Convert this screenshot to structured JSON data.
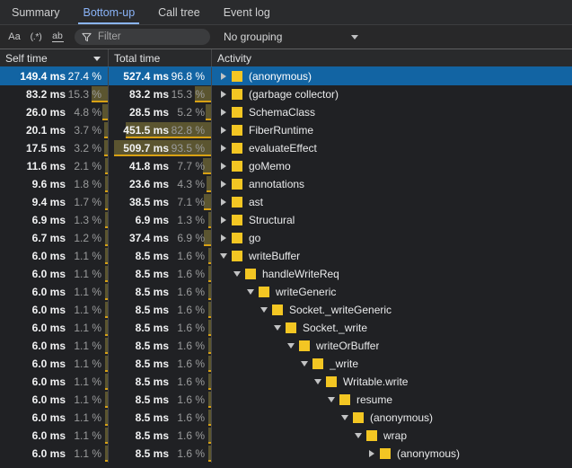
{
  "tabs": [
    {
      "label": "Summary",
      "active": false
    },
    {
      "label": "Bottom-up",
      "active": true
    },
    {
      "label": "Call tree",
      "active": false
    },
    {
      "label": "Event log",
      "active": false
    }
  ],
  "toolbar": {
    "match_case_label": "Aa",
    "regex_label": "(.*)",
    "whole_word_label": "ab",
    "filter_placeholder": "Filter",
    "filter_value": "",
    "grouping_label": "No grouping"
  },
  "columns": {
    "self_time": "Self time",
    "total_time": "Total time",
    "activity": "Activity",
    "sorted_by": "self_time",
    "sort_direction": "desc"
  },
  "colors": {
    "accent": "#8ab4f8",
    "selection": "#1264a3",
    "bar_fill": "#5b5530",
    "bar_border": "#d8a114",
    "swatch": "#f3c623",
    "background": "#202124"
  },
  "rows": [
    {
      "self_ms": "149.4 ms",
      "self_pct": "27.4 %",
      "self_pct_val": 27.4,
      "total_ms": "527.4 ms",
      "total_pct": "96.8 %",
      "total_pct_val": 96.8,
      "activity": "(anonymous)",
      "depth": 0,
      "state": "collapsed",
      "selected": true
    },
    {
      "self_ms": "83.2 ms",
      "self_pct": "15.3 %",
      "self_pct_val": 15.3,
      "total_ms": "83.2 ms",
      "total_pct": "15.3 %",
      "total_pct_val": 15.3,
      "activity": "(garbage collector)",
      "depth": 0,
      "state": "collapsed",
      "selected": false
    },
    {
      "self_ms": "26.0 ms",
      "self_pct": "4.8 %",
      "self_pct_val": 4.8,
      "total_ms": "28.5 ms",
      "total_pct": "5.2 %",
      "total_pct_val": 5.2,
      "activity": "SchemaClass",
      "depth": 0,
      "state": "collapsed",
      "selected": false
    },
    {
      "self_ms": "20.1 ms",
      "self_pct": "3.7 %",
      "self_pct_val": 3.7,
      "total_ms": "451.5 ms",
      "total_pct": "82.8 %",
      "total_pct_val": 82.8,
      "activity": "FiberRuntime",
      "depth": 0,
      "state": "collapsed",
      "selected": false
    },
    {
      "self_ms": "17.5 ms",
      "self_pct": "3.2 %",
      "self_pct_val": 3.2,
      "total_ms": "509.7 ms",
      "total_pct": "93.5 %",
      "total_pct_val": 93.5,
      "activity": "evaluateEffect",
      "depth": 0,
      "state": "collapsed",
      "selected": false
    },
    {
      "self_ms": "11.6 ms",
      "self_pct": "2.1 %",
      "self_pct_val": 2.1,
      "total_ms": "41.8 ms",
      "total_pct": "7.7 %",
      "total_pct_val": 7.7,
      "activity": "goMemo",
      "depth": 0,
      "state": "collapsed",
      "selected": false
    },
    {
      "self_ms": "9.6 ms",
      "self_pct": "1.8 %",
      "self_pct_val": 1.8,
      "total_ms": "23.6 ms",
      "total_pct": "4.3 %",
      "total_pct_val": 4.3,
      "activity": "annotations",
      "depth": 0,
      "state": "collapsed",
      "selected": false
    },
    {
      "self_ms": "9.4 ms",
      "self_pct": "1.7 %",
      "self_pct_val": 1.7,
      "total_ms": "38.5 ms",
      "total_pct": "7.1 %",
      "total_pct_val": 7.1,
      "activity": "ast",
      "depth": 0,
      "state": "collapsed",
      "selected": false
    },
    {
      "self_ms": "6.9 ms",
      "self_pct": "1.3 %",
      "self_pct_val": 1.3,
      "total_ms": "6.9 ms",
      "total_pct": "1.3 %",
      "total_pct_val": 1.3,
      "activity": "Structural",
      "depth": 0,
      "state": "collapsed",
      "selected": false
    },
    {
      "self_ms": "6.7 ms",
      "self_pct": "1.2 %",
      "self_pct_val": 1.2,
      "total_ms": "37.4 ms",
      "total_pct": "6.9 %",
      "total_pct_val": 6.9,
      "activity": "go",
      "depth": 0,
      "state": "collapsed",
      "selected": false
    },
    {
      "self_ms": "6.0 ms",
      "self_pct": "1.1 %",
      "self_pct_val": 1.1,
      "total_ms": "8.5 ms",
      "total_pct": "1.6 %",
      "total_pct_val": 1.6,
      "activity": "writeBuffer",
      "depth": 0,
      "state": "expanded",
      "selected": false
    },
    {
      "self_ms": "6.0 ms",
      "self_pct": "1.1 %",
      "self_pct_val": 1.1,
      "total_ms": "8.5 ms",
      "total_pct": "1.6 %",
      "total_pct_val": 1.6,
      "activity": "handleWriteReq",
      "depth": 1,
      "state": "expanded",
      "selected": false
    },
    {
      "self_ms": "6.0 ms",
      "self_pct": "1.1 %",
      "self_pct_val": 1.1,
      "total_ms": "8.5 ms",
      "total_pct": "1.6 %",
      "total_pct_val": 1.6,
      "activity": "writeGeneric",
      "depth": 2,
      "state": "expanded",
      "selected": false
    },
    {
      "self_ms": "6.0 ms",
      "self_pct": "1.1 %",
      "self_pct_val": 1.1,
      "total_ms": "8.5 ms",
      "total_pct": "1.6 %",
      "total_pct_val": 1.6,
      "activity": "Socket._writeGeneric",
      "depth": 3,
      "state": "expanded",
      "selected": false
    },
    {
      "self_ms": "6.0 ms",
      "self_pct": "1.1 %",
      "self_pct_val": 1.1,
      "total_ms": "8.5 ms",
      "total_pct": "1.6 %",
      "total_pct_val": 1.6,
      "activity": "Socket._write",
      "depth": 4,
      "state": "expanded",
      "selected": false
    },
    {
      "self_ms": "6.0 ms",
      "self_pct": "1.1 %",
      "self_pct_val": 1.1,
      "total_ms": "8.5 ms",
      "total_pct": "1.6 %",
      "total_pct_val": 1.6,
      "activity": "writeOrBuffer",
      "depth": 5,
      "state": "expanded",
      "selected": false
    },
    {
      "self_ms": "6.0 ms",
      "self_pct": "1.1 %",
      "self_pct_val": 1.1,
      "total_ms": "8.5 ms",
      "total_pct": "1.6 %",
      "total_pct_val": 1.6,
      "activity": "_write",
      "depth": 6,
      "state": "expanded",
      "selected": false
    },
    {
      "self_ms": "6.0 ms",
      "self_pct": "1.1 %",
      "self_pct_val": 1.1,
      "total_ms": "8.5 ms",
      "total_pct": "1.6 %",
      "total_pct_val": 1.6,
      "activity": "Writable.write",
      "depth": 7,
      "state": "expanded",
      "selected": false
    },
    {
      "self_ms": "6.0 ms",
      "self_pct": "1.1 %",
      "self_pct_val": 1.1,
      "total_ms": "8.5 ms",
      "total_pct": "1.6 %",
      "total_pct_val": 1.6,
      "activity": "resume",
      "depth": 8,
      "state": "expanded",
      "selected": false
    },
    {
      "self_ms": "6.0 ms",
      "self_pct": "1.1 %",
      "self_pct_val": 1.1,
      "total_ms": "8.5 ms",
      "total_pct": "1.6 %",
      "total_pct_val": 1.6,
      "activity": "(anonymous)",
      "depth": 9,
      "state": "expanded",
      "selected": false
    },
    {
      "self_ms": "6.0 ms",
      "self_pct": "1.1 %",
      "self_pct_val": 1.1,
      "total_ms": "8.5 ms",
      "total_pct": "1.6 %",
      "total_pct_val": 1.6,
      "activity": "wrap",
      "depth": 10,
      "state": "expanded",
      "selected": false
    },
    {
      "self_ms": "6.0 ms",
      "self_pct": "1.1 %",
      "self_pct_val": 1.1,
      "total_ms": "8.5 ms",
      "total_pct": "1.6 %",
      "total_pct_val": 1.6,
      "activity": "(anonymous)",
      "depth": 11,
      "state": "collapsed",
      "selected": false
    }
  ]
}
